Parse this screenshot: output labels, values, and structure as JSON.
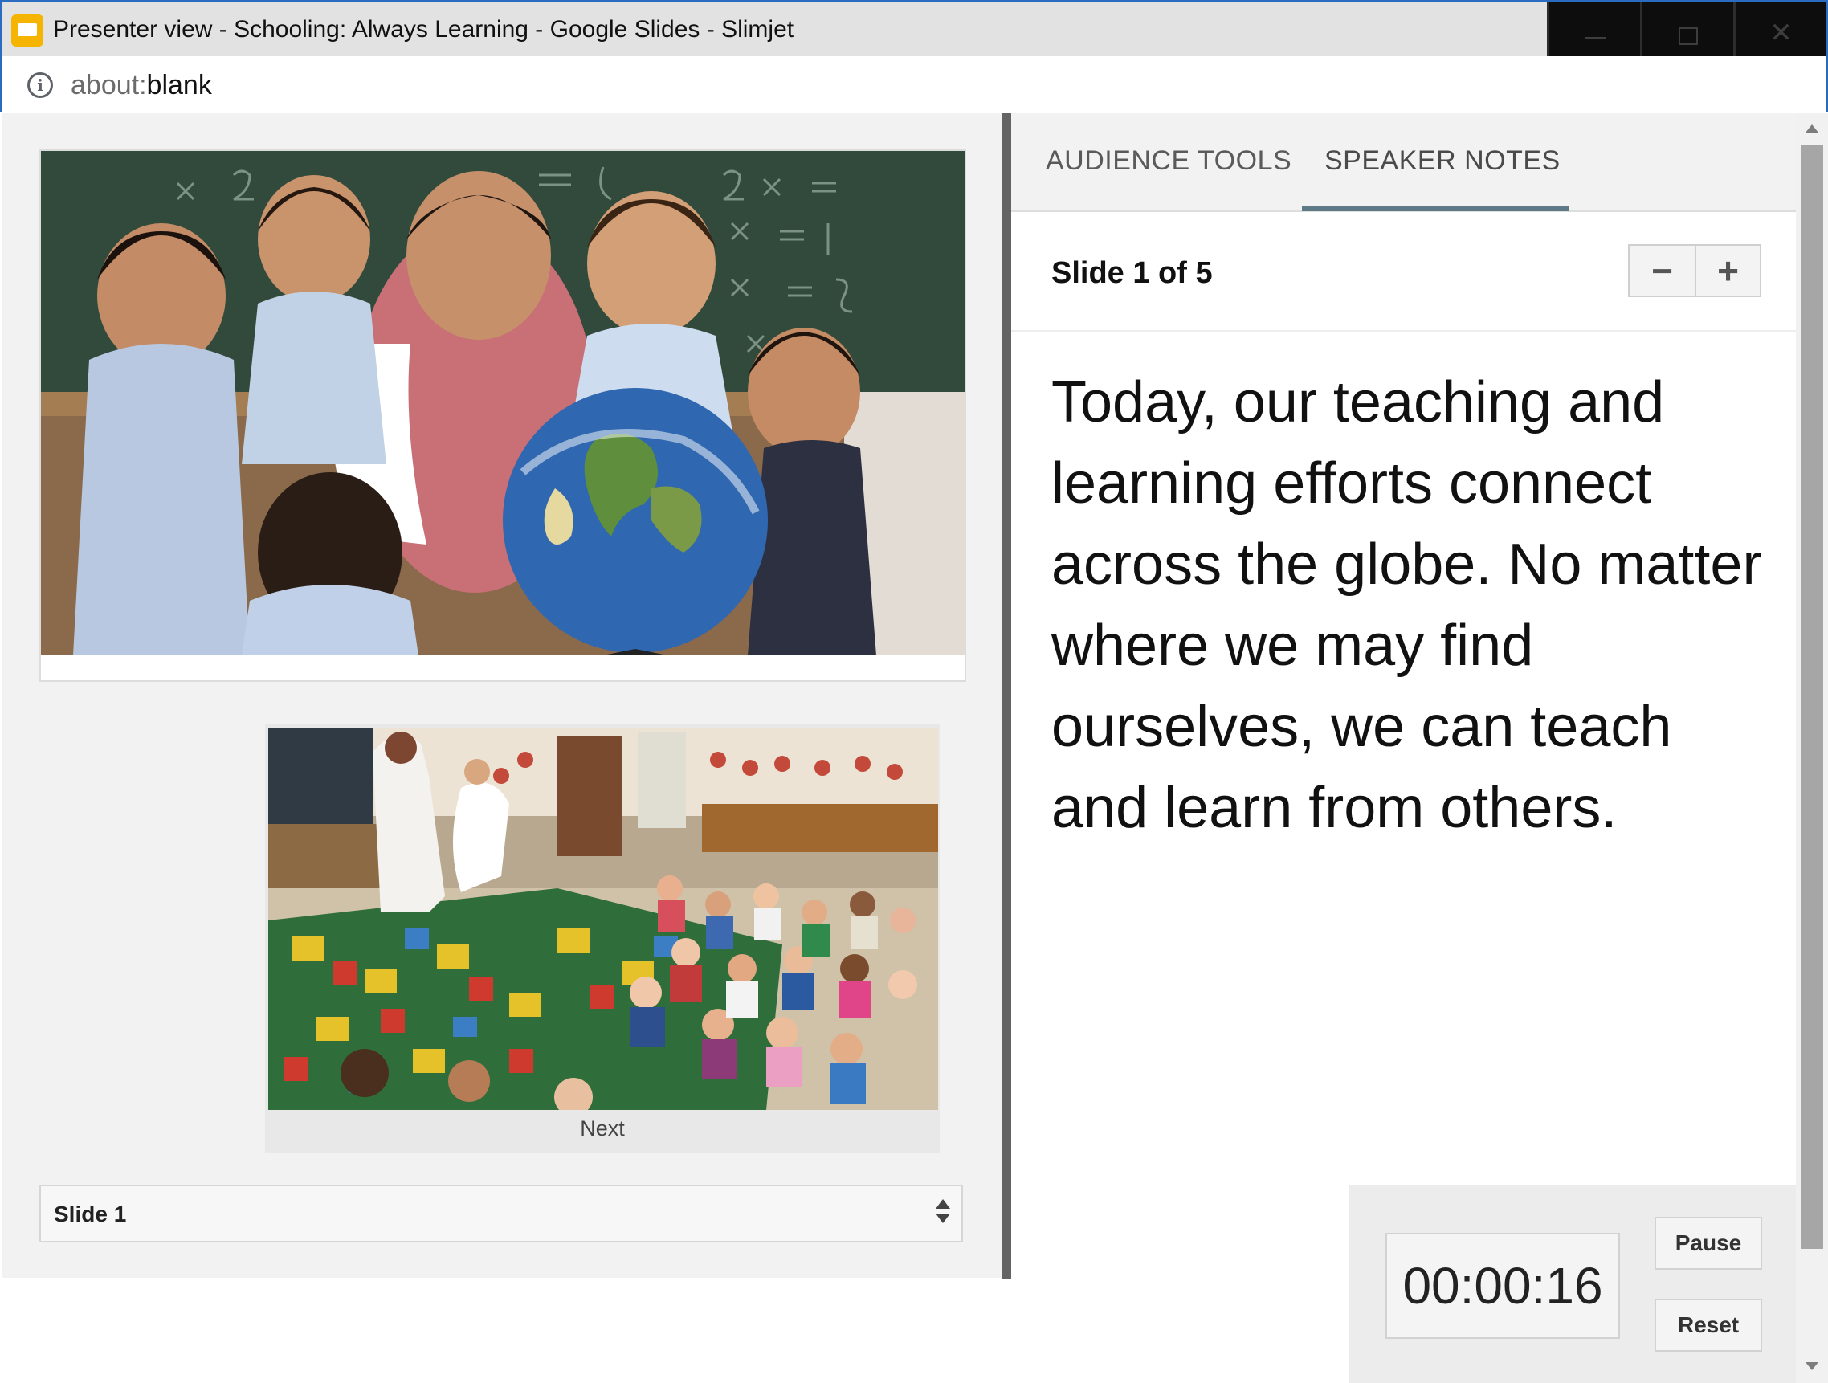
{
  "window": {
    "title": "Presenter view - Schooling: Always Learning - Google Slides - Slimjet",
    "app_icon": "google-slides-icon",
    "controls": [
      "minimize-icon",
      "maximize-icon",
      "close-icon"
    ]
  },
  "address_bar": {
    "icon": "info-icon",
    "url_scheme": "about:",
    "url_host": "blank"
  },
  "left_pane": {
    "next_label": "Next",
    "slide_select": {
      "selected": "Slide 1"
    }
  },
  "right_pane": {
    "tabs": [
      {
        "label": "AUDIENCE TOOLS",
        "active": false
      },
      {
        "label": "SPEAKER NOTES",
        "active": true
      }
    ],
    "slide_counter": "Slide 1 of 5",
    "zoom_out_label": "−",
    "zoom_in_label": "+",
    "notes": "Today, our teaching and learning efforts connect across the globe. No matter where we may find ourselves, we can teach and learn from others.",
    "timer": {
      "value": "00:00:16",
      "pause_label": "Pause",
      "reset_label": "Reset"
    }
  },
  "colors": {
    "window_border": "#2b6cc0",
    "tab_underline": "#5f7a87",
    "pane_divider": "#646464",
    "slides_accent": "#f4b400"
  }
}
